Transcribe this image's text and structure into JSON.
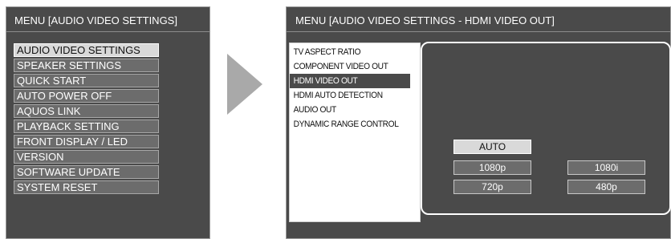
{
  "left_screen": {
    "title": "MENU   [AUDIO VIDEO SETTINGS]",
    "menu_items": [
      {
        "label": "AUDIO VIDEO SETTINGS",
        "selected": true
      },
      {
        "label": "SPEAKER SETTINGS",
        "selected": false
      },
      {
        "label": "QUICK START",
        "selected": false
      },
      {
        "label": "AUTO POWER OFF",
        "selected": false
      },
      {
        "label": "AQUOS LINK",
        "selected": false
      },
      {
        "label": "PLAYBACK SETTING",
        "selected": false
      },
      {
        "label": "FRONT DISPLAY / LED",
        "selected": false
      },
      {
        "label": "VERSION",
        "selected": false
      },
      {
        "label": "SOFTWARE UPDATE",
        "selected": false
      },
      {
        "label": "SYSTEM RESET",
        "selected": false
      }
    ]
  },
  "arrow": {
    "icon": "right-arrow-icon"
  },
  "right_screen": {
    "title": "MENU   [AUDIO VIDEO SETTINGS - HDMI VIDEO OUT]",
    "submenu_items": [
      {
        "label": "TV ASPECT RATIO",
        "selected": false
      },
      {
        "label": "COMPONENT VIDEO OUT",
        "selected": false
      },
      {
        "label": "HDMI VIDEO OUT",
        "selected": true
      },
      {
        "label": "HDMI AUTO DETECTION",
        "selected": false
      },
      {
        "label": "AUDIO OUT",
        "selected": false
      },
      {
        "label": "DYNAMIC RANGE CONTROL",
        "selected": false
      }
    ],
    "options": {
      "auto": "AUTO",
      "p1080": "1080p",
      "i1080": "1080i",
      "p720": "720p",
      "p480": "480p",
      "selected": "AUTO"
    }
  },
  "colors": {
    "screen_bg": "#4a4a4a",
    "item_bg": "#6c6c6c",
    "selected_bg": "#d9d9d9",
    "text_light": "#ffffff",
    "text_dark": "#111111"
  }
}
